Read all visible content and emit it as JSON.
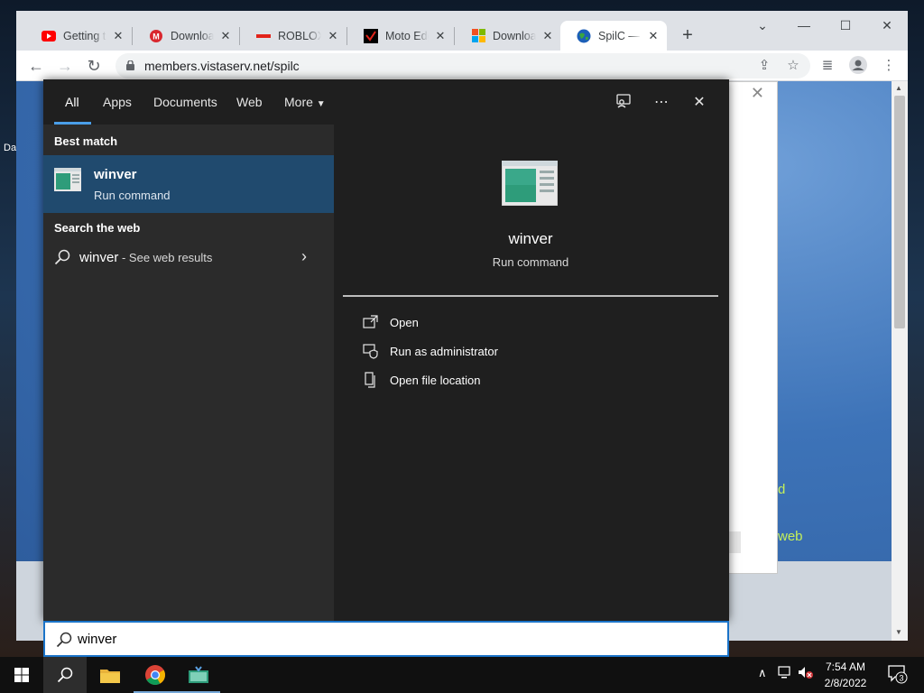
{
  "browser": {
    "tabs": [
      {
        "title": "Getting th",
        "favicon": "youtube-icon"
      },
      {
        "title": "Download",
        "favicon": "mega-icon"
      },
      {
        "title": "ROBLOX",
        "favicon": "roblox-icon"
      },
      {
        "title": "Moto Edg",
        "favicon": "verizon-icon"
      },
      {
        "title": "Download",
        "favicon": "microsoft-icon"
      },
      {
        "title": "SpilC — V",
        "favicon": "globe-icon"
      }
    ],
    "url": "members.vistaserv.net/spilc"
  },
  "page": {
    "green_text_1": "d",
    "green_text_2": "web"
  },
  "desktop": {
    "frag_1": "Da"
  },
  "search_panel": {
    "tabs": [
      "All",
      "Apps",
      "Documents",
      "Web",
      "More"
    ],
    "best_match_title": "Best match",
    "best_match": {
      "name": "winver",
      "subtitle": "Run command"
    },
    "search_web_title": "Search the web",
    "web_result": {
      "term": "winver",
      "suffix": " - See web results"
    },
    "preview": {
      "name": "winver",
      "subtitle": "Run command"
    },
    "actions": [
      "Open",
      "Run as administrator",
      "Open file location"
    ],
    "query": "winver"
  },
  "taskbar": {
    "time": "7:54 AM",
    "date": "2/8/2022",
    "notification_count": "3"
  },
  "colors": {
    "accent": "#1a73c8",
    "selected_item": "#204a6e",
    "panel_bg": "#1f1f1f"
  }
}
